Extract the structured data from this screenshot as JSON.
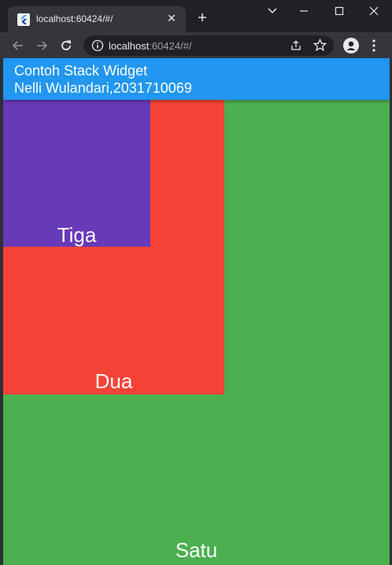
{
  "browser": {
    "tab_title": "localhost:60424/#/",
    "tab_close_glyph": "✕",
    "new_tab_glyph": "+",
    "url_host": "localhost",
    "url_path": ":60424/#/",
    "icons": {
      "favicon": "flutter-icon",
      "back": "back-arrow-icon",
      "forward": "forward-arrow-icon",
      "reload": "reload-icon",
      "info": "info-icon",
      "share": "share-icon",
      "bookmark": "star-icon",
      "profile": "profile-icon",
      "menu": "kebab-menu-icon",
      "tab_search": "chevron-down-icon",
      "minimize": "minimize-icon",
      "maximize": "maximize-icon",
      "close": "close-icon"
    }
  },
  "app": {
    "title_line1": "Contoh Stack Widget",
    "title_line2": "Nelli Wulandari,2031710069",
    "appbar_color": "#2196f3",
    "boxes": [
      {
        "label": "Satu",
        "color": "#4caf50"
      },
      {
        "label": "Dua",
        "color": "#f44336"
      },
      {
        "label": "Tiga",
        "color": "#673ab7"
      }
    ]
  }
}
